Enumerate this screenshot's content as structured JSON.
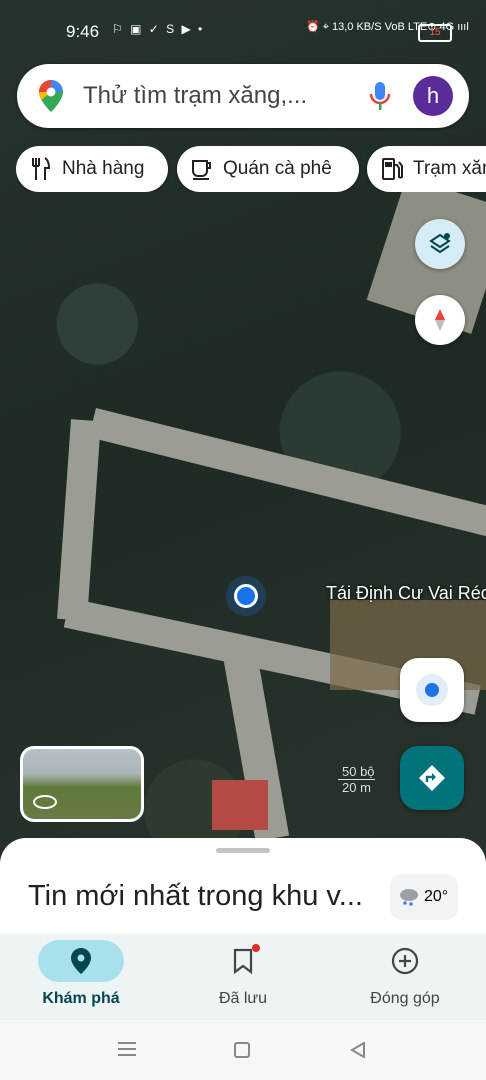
{
  "status": {
    "time": "9:46",
    "notif_icons": "⚐ ▣ ✓ S ▶ •",
    "right_icons": "⏰ ⌖ 13,0 KB/S VoB LTE⊙ 4G ıııl",
    "battery": "15"
  },
  "search": {
    "placeholder": "Thử tìm trạm xăng,...",
    "avatar_letter": "h"
  },
  "chips": [
    {
      "label": "Nhà hàng",
      "icon": "fork-knife-icon"
    },
    {
      "label": "Quán cà phê",
      "icon": "coffee-icon"
    },
    {
      "label": "Trạm xăng",
      "icon": "gas-station-icon"
    }
  ],
  "map": {
    "place_label": "Tái Định Cư Vai Réc",
    "scale_ft": "50 bộ",
    "scale_m": "20 m"
  },
  "sheet": {
    "title": "Tin mới nhất trong khu v...",
    "temperature": "20°"
  },
  "nav": [
    {
      "label": "Khám phá",
      "icon": "location-pin-icon",
      "active": true
    },
    {
      "label": "Đã lưu",
      "icon": "bookmark-icon",
      "active": false
    },
    {
      "label": "Đóng góp",
      "icon": "add-circle-icon",
      "active": false
    }
  ],
  "colors": {
    "accent_teal": "#00747a",
    "active_pill": "#a8e0ec",
    "location_blue": "#1a73e8",
    "avatar": "#5b2b9a"
  }
}
